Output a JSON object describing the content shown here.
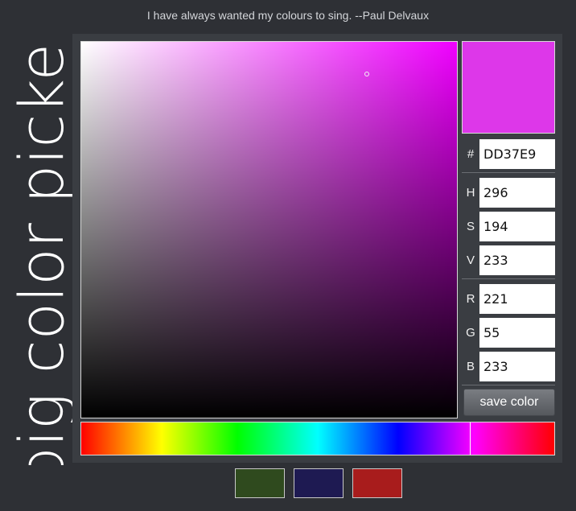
{
  "header": {
    "quote": "I have always wanted my colours to sing. --Paul Delvaux"
  },
  "title": "big color picker",
  "picker": {
    "current_color": "#dd37e9",
    "hue_color": "#f000ff",
    "hue_fraction": 0.822,
    "saturation_fraction": 0.761,
    "value_fraction": 0.914
  },
  "fields": {
    "hex": {
      "label": "#",
      "value": "DD37E9"
    },
    "h": {
      "label": "H",
      "value": "296"
    },
    "s": {
      "label": "S",
      "value": "194"
    },
    "v": {
      "label": "V",
      "value": "233"
    },
    "r": {
      "label": "R",
      "value": "221"
    },
    "g": {
      "label": "G",
      "value": "55"
    },
    "b": {
      "label": "B",
      "value": "233"
    }
  },
  "save_button": {
    "label": "save color"
  },
  "saved_swatches": [
    {
      "color": "#2f4a1e"
    },
    {
      "color": "#1e1a52"
    },
    {
      "color": "#a81c1c"
    }
  ]
}
